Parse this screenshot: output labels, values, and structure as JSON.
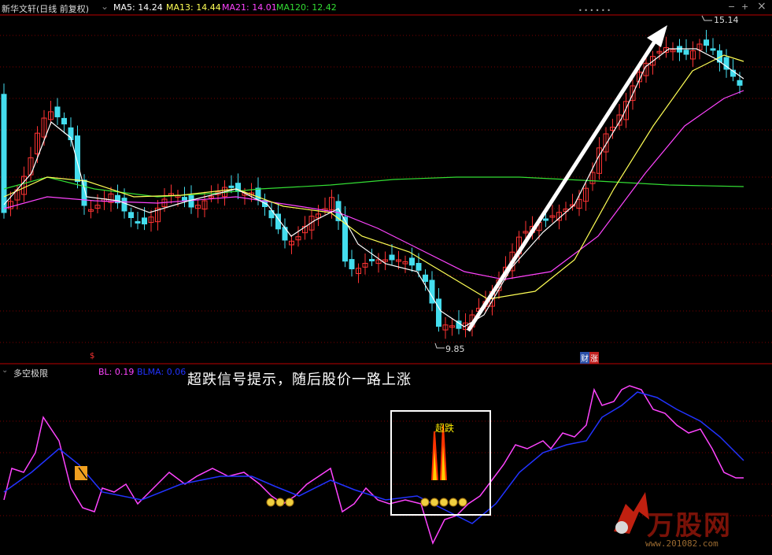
{
  "main_panel": {
    "stock_name": "新华文轩",
    "period": "(日线 前复权)",
    "ma_labels": [
      {
        "label": "MA5: 14.24",
        "color": "#ffffff"
      },
      {
        "label": "MA13: 14.44",
        "color": "#ffff55"
      },
      {
        "label": "MA21: 14.01",
        "color": "#ff44ff"
      },
      {
        "label": "MA120: 12.42",
        "color": "#33dd33"
      }
    ],
    "high_marker": "15.14",
    "low_marker": "9.85",
    "event_caicao": "财",
    "event_zhang": "涨",
    "s_marker": "$"
  },
  "indicator_panel": {
    "name": "多空极限",
    "bl_label": "BL: 0.19",
    "blma_label": "BLMA: 0.06",
    "bl_color": "#ff44ff",
    "blma_color": "#2233ff",
    "signal_label": "超跌"
  },
  "annotation": "超跌信号提示，随后股价一路上涨",
  "controls": {
    "minus": "−",
    "plus": "+",
    "close": "×",
    "dots": "• • • • • •"
  },
  "watermark": {
    "text": "万股网",
    "url": "www.201082.com"
  },
  "colors": {
    "up": "#ff3333",
    "down": "#44ddee",
    "grid": "#7a0000",
    "separator": "#bb0000"
  }
}
